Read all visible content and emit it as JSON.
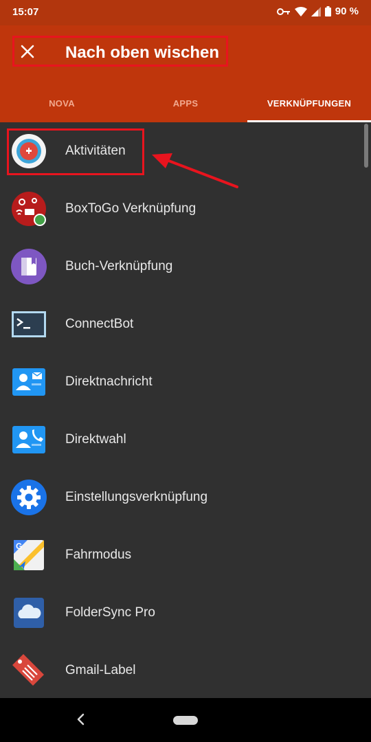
{
  "status_bar": {
    "time": "15:07",
    "battery": "90 %"
  },
  "header": {
    "title": "Nach oben wischen"
  },
  "tabs": [
    {
      "label": "NOVA",
      "active": false
    },
    {
      "label": "APPS",
      "active": false
    },
    {
      "label": "VERKNÜPFUNGEN",
      "active": true
    }
  ],
  "shortcuts": [
    {
      "label": "Aktivitäten",
      "icon": "activities-icon"
    },
    {
      "label": "BoxToGo Verknüpfung",
      "icon": "boxtogo-icon"
    },
    {
      "label": "Buch-Verknüpfung",
      "icon": "book-icon"
    },
    {
      "label": "ConnectBot",
      "icon": "terminal-icon"
    },
    {
      "label": "Direktnachricht",
      "icon": "contact-message-icon"
    },
    {
      "label": "Direktwahl",
      "icon": "contact-call-icon"
    },
    {
      "label": "Einstellungsverknüpfung",
      "icon": "settings-gear-icon"
    },
    {
      "label": "Fahrmodus",
      "icon": "maps-navigation-icon"
    },
    {
      "label": "FolderSync Pro",
      "icon": "cloud-icon"
    },
    {
      "label": "Gmail-Label",
      "icon": "label-tag-icon"
    }
  ],
  "colors": {
    "appbar": "#BF360C",
    "statusbar": "#B2360D",
    "list_bg": "#303030",
    "annotation": "#E8141E"
  }
}
